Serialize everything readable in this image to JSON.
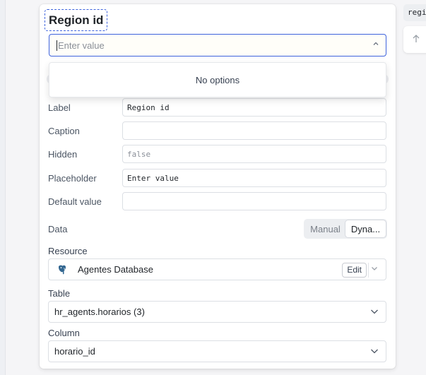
{
  "field_title": "Region id",
  "select": {
    "placeholder": "Enter value",
    "dropdown_message": "No options"
  },
  "properties": [
    {
      "label": "Label",
      "value": "Region id",
      "muted": false
    },
    {
      "label": "Caption",
      "value": "",
      "muted": false
    },
    {
      "label": "Hidden",
      "value": "false",
      "muted": true
    },
    {
      "label": "Placeholder",
      "value": "Enter value",
      "muted": false
    },
    {
      "label": "Default value",
      "value": "",
      "muted": false
    }
  ],
  "data": {
    "label": "Data",
    "options": [
      "Manual",
      "Dyna..."
    ],
    "selected": "Dyna..."
  },
  "resource": {
    "label": "Resource",
    "name": "Agentes Database",
    "icon": "postgres-elephant-icon",
    "edit_label": "Edit"
  },
  "table": {
    "label": "Table",
    "value": "hr_agents.horarios (3)"
  },
  "column": {
    "label": "Column",
    "value": "horario_id"
  },
  "right_chip": "regi",
  "colors": {
    "accent": "#3e63dd",
    "panel_bg": "#ffffff",
    "page_bg": "#f5f5f7"
  }
}
